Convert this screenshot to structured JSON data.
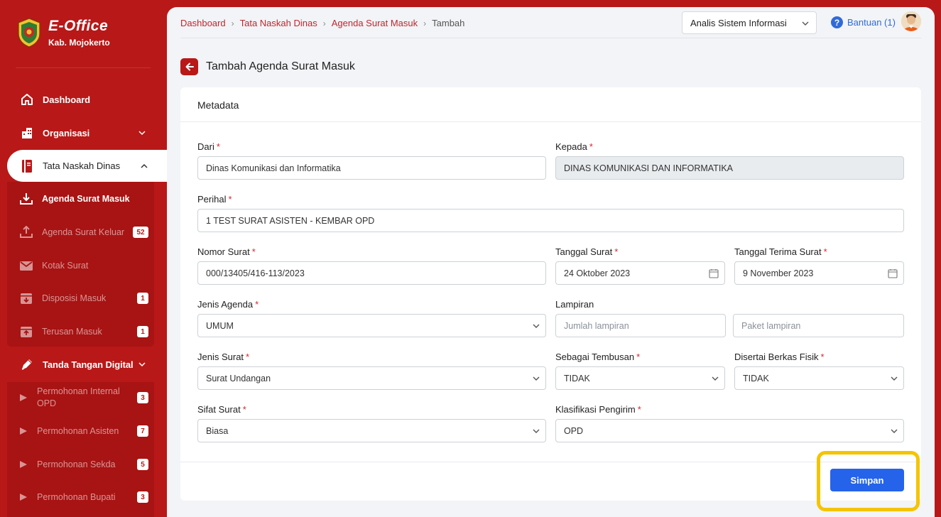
{
  "brand": {
    "title": "E-Office",
    "subtitle": "Kab. Mojokerto"
  },
  "sidebar": {
    "items": [
      {
        "label": "Dashboard",
        "icon": "home-icon"
      },
      {
        "label": "Organisasi",
        "icon": "building-icon"
      },
      {
        "label": "Tata Naskah Dinas",
        "icon": "book-icon"
      },
      {
        "label": "Tanda Tangan Digital",
        "icon": "pen-icon"
      }
    ],
    "naskah_sub": [
      {
        "label": "Agenda Surat Masuk",
        "icon": "inbox-download-icon",
        "badge": ""
      },
      {
        "label": "Agenda Surat Keluar",
        "icon": "outbox-upload-icon",
        "badge": "52"
      },
      {
        "label": "Kotak Surat",
        "icon": "mail-icon",
        "badge": ""
      },
      {
        "label": "Disposisi Masuk",
        "icon": "disposition-in-icon",
        "badge": "1"
      },
      {
        "label": "Terusan Masuk",
        "icon": "forward-in-icon",
        "badge": "1"
      }
    ],
    "ttd_sub": [
      {
        "label": "Permohonan Internal OPD",
        "badge": "3"
      },
      {
        "label": "Permohonan Asisten",
        "badge": "7"
      },
      {
        "label": "Permohonan Sekda",
        "badge": "5"
      },
      {
        "label": "Permohonan Bupati",
        "badge": "3"
      }
    ]
  },
  "breadcrumb": {
    "items": [
      "Dashboard",
      "Tata Naskah Dinas",
      "Agenda Surat Masuk"
    ],
    "current": "Tambah"
  },
  "topbar": {
    "role": "Analis Sistem Informasi",
    "help": "Bantuan (1)"
  },
  "page": {
    "title": "Tambah Agenda Surat Masuk"
  },
  "form": {
    "section_title": "Metadata",
    "required_mark": "*",
    "dari": {
      "label": "Dari",
      "value": "Dinas Komunikasi dan Informatika"
    },
    "kepada": {
      "label": "Kepada",
      "value": "DINAS KOMUNIKASI DAN INFORMATIKA"
    },
    "perihal": {
      "label": "Perihal",
      "value": "1 TEST SURAT ASISTEN - KEMBAR OPD"
    },
    "nomor_surat": {
      "label": "Nomor Surat",
      "value": "000/13405/416-113/2023"
    },
    "tanggal_surat": {
      "label": "Tanggal Surat",
      "value": "24 Oktober 2023"
    },
    "tanggal_terima": {
      "label": "Tanggal Terima Surat",
      "value": "9 November 2023"
    },
    "jenis_agenda": {
      "label": "Jenis Agenda",
      "value": "UMUM"
    },
    "lampiran": {
      "label": "Lampiran",
      "placeholder_jumlah": "Jumlah lampiran",
      "placeholder_paket": "Paket lampiran"
    },
    "jenis_surat": {
      "label": "Jenis Surat",
      "value": "Surat Undangan"
    },
    "tembusan": {
      "label": "Sebagai Tembusan",
      "value": "TIDAK"
    },
    "berkas_fisik": {
      "label": "Disertai Berkas Fisik",
      "value": "TIDAK"
    },
    "sifat_surat": {
      "label": "Sifat Surat",
      "value": "Biasa"
    },
    "klasifikasi": {
      "label": "Klasifikasi Pengirim",
      "value": "OPD"
    },
    "save_label": "Simpan"
  },
  "colors": {
    "sidebar": "#b81818",
    "primary_button": "#2563eb",
    "highlight": "#f5c400"
  }
}
